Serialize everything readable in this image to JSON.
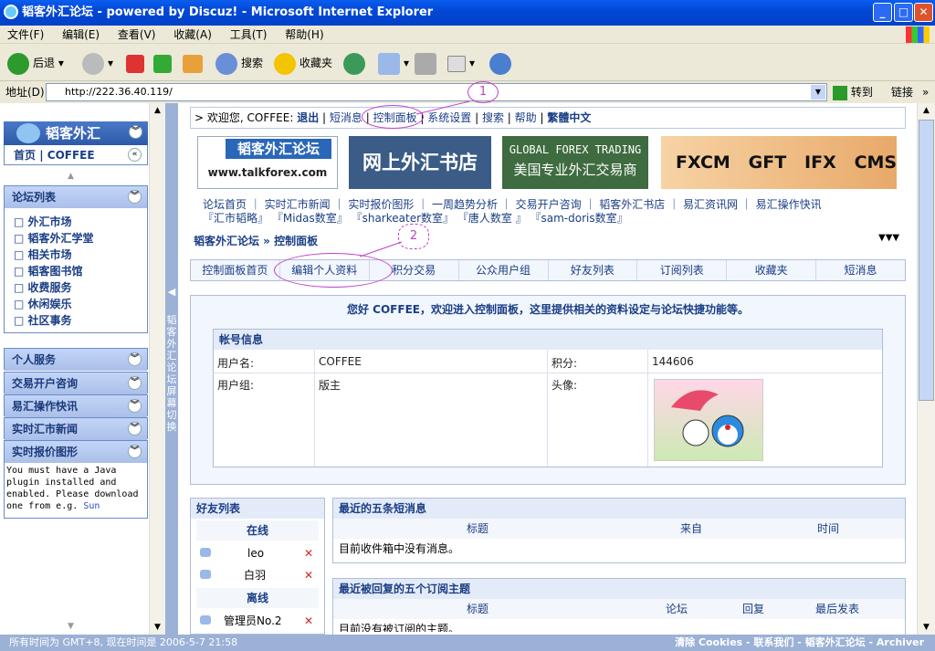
{
  "window": {
    "title": "韬客外汇论坛 - powered by Discuz! - Microsoft Internet Explorer"
  },
  "menu": [
    "文件(F)",
    "编辑(E)",
    "查看(V)",
    "收藏(A)",
    "工具(T)",
    "帮助(H)"
  ],
  "toolbar": {
    "back": "后退",
    "search": "搜索",
    "favorites": "收藏夹"
  },
  "address": {
    "label": "地址(D)",
    "url": "http://222.36.40.119/",
    "go": "转到",
    "links": "链接"
  },
  "sidebar": {
    "logo": "韬客外汇",
    "home": "首页",
    "user": "COFFEE",
    "forum_list": "论坛列表",
    "forums": [
      "外汇市场",
      "韬客外汇学堂",
      "相关市场",
      "韬客图书馆",
      "收费服务",
      "休闲娱乐",
      "社区事务"
    ],
    "sections": [
      "个人服务",
      "交易开户咨询",
      "易汇操作快讯",
      "实时汇市新闻",
      "实时报价图形"
    ],
    "java_msg": "You must have a Java plugin installed and enabled. Please download one from e.g.",
    "java_link": "Sun",
    "split": "韬客外汇论坛屏幕切换"
  },
  "topnav": {
    "welcome": "欢迎您, COFFEE:",
    "items": [
      "退出",
      "短消息",
      "控制面板",
      "系统设置",
      "搜索",
      "帮助"
    ],
    "trad": "繁體中文"
  },
  "banners": [
    "韬客外汇论坛",
    "www.talkforex.com",
    "网上外汇书店",
    "GLOBAL FOREX TRADING",
    "美国专业外汇交易商",
    "FXCM   GFT   IFX   CMS"
  ],
  "links": {
    "row1": [
      "论坛首页",
      "实时汇市新闻",
      "实时报价图形",
      "一周趋势分析",
      "交易开户咨询",
      "韬客外汇书店",
      "易汇资讯网",
      "易汇操作快讯"
    ],
    "row2": [
      "『汇市韬略』",
      "『Midas数室』",
      "『sharkeater数室』",
      "『唐人数室 』",
      "『sam-doris数室』"
    ]
  },
  "crumb": "韬客外汇论坛 » 控制面板",
  "tabs": [
    "控制面板首页",
    "编辑个人资料",
    "积分交易",
    "公众用户组",
    "好友列表",
    "订阅列表",
    "收藏夹",
    "短消息"
  ],
  "welcome": "您好  COFFEE，欢迎进入控制面板，这里提供相关的资料设定与论坛快捷功能等。",
  "account": {
    "title": "帐号信息",
    "username_label": "用户名:",
    "username": "COFFEE",
    "points_label": "积分:",
    "points": "144606",
    "group_label": "用户组:",
    "group": "版主",
    "avatar_label": "头像:"
  },
  "friends": {
    "title": "好友列表",
    "online": "在线",
    "offline": "离线",
    "online_list": [
      "leo",
      "白羽"
    ],
    "offline_list": [
      "管理员No.2"
    ]
  },
  "messages": {
    "title": "最近的五条短消息",
    "cols": [
      "标题",
      "来自",
      "时间"
    ],
    "empty": "目前收件箱中没有消息。"
  },
  "subs": {
    "title": "最近被回复的五个订阅主题",
    "cols": [
      "标题",
      "论坛",
      "回复",
      "最后发表"
    ],
    "empty": "目前没有被订阅的主题。"
  },
  "annotations": [
    "1",
    "2"
  ],
  "status": {
    "time": "所有时间为  GMT+8, 现在时间是  2006-5-7 21:58",
    "right": "清除  Cookies - 联系我们 - 韬客外汇论坛 - Archiver"
  }
}
